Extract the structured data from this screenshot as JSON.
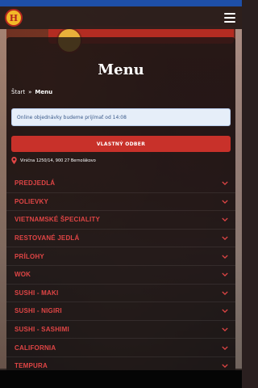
{
  "header": {
    "logo_text": "H",
    "menu_icon": "hamburger-icon"
  },
  "page": {
    "title": "Menu"
  },
  "breadcrumb": {
    "home": "Štart",
    "separator": "»",
    "current": "Menu"
  },
  "notice": {
    "text": "Online objednávky budeme prijímať od 14:08"
  },
  "order_button": {
    "label": "VLASTNÝ ODBER"
  },
  "address": {
    "icon": "map-pin-icon",
    "text": "Vinična 1250/14, 900 27 Bernolákovo"
  },
  "categories": [
    {
      "label": "PREDJEDLÁ"
    },
    {
      "label": "POLIEVKY"
    },
    {
      "label": "VIETNAMSKÉ ŠPECIALITY"
    },
    {
      "label": "RESTOVANÉ JEDLÁ"
    },
    {
      "label": "PRÍLOHY"
    },
    {
      "label": "WOK"
    },
    {
      "label": "SUSHI - MAKI"
    },
    {
      "label": "SUSHI - NIGIRI"
    },
    {
      "label": "SUSHI - SASHIMI"
    },
    {
      "label": "CALIFORNIA"
    },
    {
      "label": "TEMPURA"
    }
  ],
  "colors": {
    "accent": "#c8312a",
    "category_text": "#e04545",
    "top_strip": "#1e4fa8"
  }
}
